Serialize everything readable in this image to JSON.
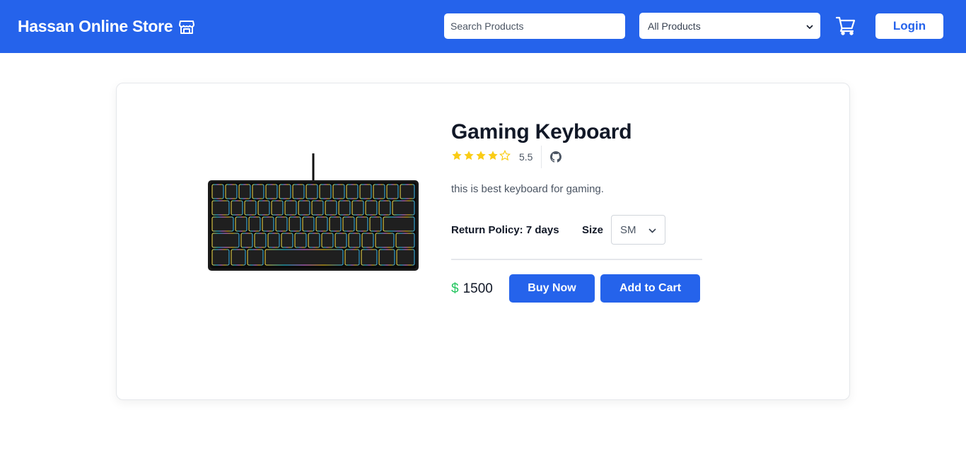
{
  "header": {
    "brand": "Hassan Online Store",
    "brand_icon": "store-icon",
    "search": {
      "placeholder": "Search Products",
      "value": ""
    },
    "category": {
      "selected": "All Products"
    },
    "cart_icon": "cart-icon",
    "login_label": "Login",
    "bg_color": "#2563eb"
  },
  "product": {
    "name": "Gaming Keyboard",
    "rating": {
      "stars_filled": 4,
      "stars_total": 5,
      "value": "5.5",
      "star_color": "#facc15"
    },
    "github_icon": "github-icon",
    "description": "this is best keyboard for gaming.",
    "return_policy": "Return Policy: 7 days",
    "size": {
      "label": "Size",
      "selected": "SM"
    },
    "price": {
      "currency": "$",
      "amount": "1500",
      "currency_color": "#22c55e"
    },
    "buy_label": "Buy Now",
    "add_label": "Add to Cart",
    "image_icon": "keyboard-image"
  }
}
